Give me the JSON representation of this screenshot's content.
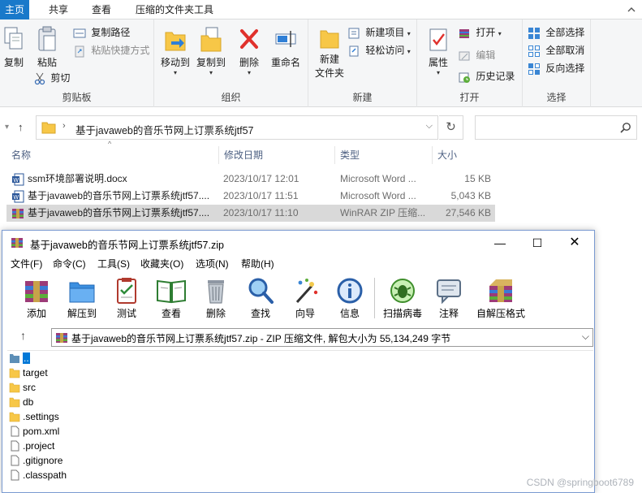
{
  "ribbon_tabs": [
    {
      "label": "主页",
      "active": true
    },
    {
      "label": "共享",
      "active": false
    },
    {
      "label": "查看",
      "active": false
    },
    {
      "label": "压缩的文件夹工具",
      "active": false
    }
  ],
  "ribbon": {
    "clipboard": {
      "group": "剪贴板",
      "copy": "复制",
      "paste": "粘贴",
      "copy_path": "复制路径",
      "paste_shortcut": "粘贴快捷方式",
      "cut": "剪切"
    },
    "organize": {
      "group": "组织",
      "move_to": "移动到",
      "copy_to": "复制到",
      "delete": "删除",
      "rename": "重命名"
    },
    "new": {
      "group": "新建",
      "new_folder_line1": "新建",
      "new_folder_line2": "文件夹",
      "new_item": "新建项目",
      "easy_access": "轻松访问"
    },
    "open": {
      "group": "打开",
      "properties": "属性",
      "open": "打开",
      "edit": "编辑",
      "history": "历史记录"
    },
    "select": {
      "group": "选择",
      "select_all": "全部选择",
      "select_none": "全部取消",
      "invert": "反向选择"
    }
  },
  "address": {
    "path": "基于javaweb的音乐节网上订票系统jtf57"
  },
  "columns": {
    "name": "名称",
    "date": "修改日期",
    "type": "类型",
    "size": "大小"
  },
  "files": [
    {
      "name": "ssm环境部署说明.docx",
      "date": "2023/10/17 12:01",
      "type": "Microsoft Word ...",
      "size": "15 KB",
      "icon": "word-icon"
    },
    {
      "name": "基于javaweb的音乐节网上订票系统jtf57....",
      "date": "2023/10/17 11:51",
      "type": "Microsoft Word ...",
      "size": "5,043 KB",
      "icon": "word-icon"
    },
    {
      "name": "基于javaweb的音乐节网上订票系统jtf57....",
      "date": "2023/10/17 11:10",
      "type": "WinRAR ZIP 压缩...",
      "size": "27,546 KB",
      "icon": "winrar-icon"
    }
  ],
  "winrar": {
    "title": "基于javaweb的音乐节网上订票系统jtf57.zip",
    "menu": [
      "文件(F)",
      "命令(C)",
      "工具(S)",
      "收藏夹(O)",
      "选项(N)",
      "帮助(H)"
    ],
    "toolbar": [
      "添加",
      "解压到",
      "测试",
      "查看",
      "删除",
      "查找",
      "向导",
      "信息",
      "扫描病毒",
      "注释",
      "自解压格式"
    ],
    "path": "基于javaweb的音乐节网上订票系统jtf57.zip - ZIP 压缩文件, 解包大小为 55,134,249 字节",
    "items": [
      {
        "name": "..",
        "kind": "up"
      },
      {
        "name": "target",
        "kind": "folder"
      },
      {
        "name": "src",
        "kind": "folder"
      },
      {
        "name": "db",
        "kind": "folder"
      },
      {
        "name": ".settings",
        "kind": "folder"
      },
      {
        "name": "pom.xml",
        "kind": "file"
      },
      {
        "name": ".project",
        "kind": "file"
      },
      {
        "name": ".gitignore",
        "kind": "file"
      },
      {
        "name": ".classpath",
        "kind": "file"
      }
    ]
  },
  "watermark": "CSDN @springboot6789"
}
